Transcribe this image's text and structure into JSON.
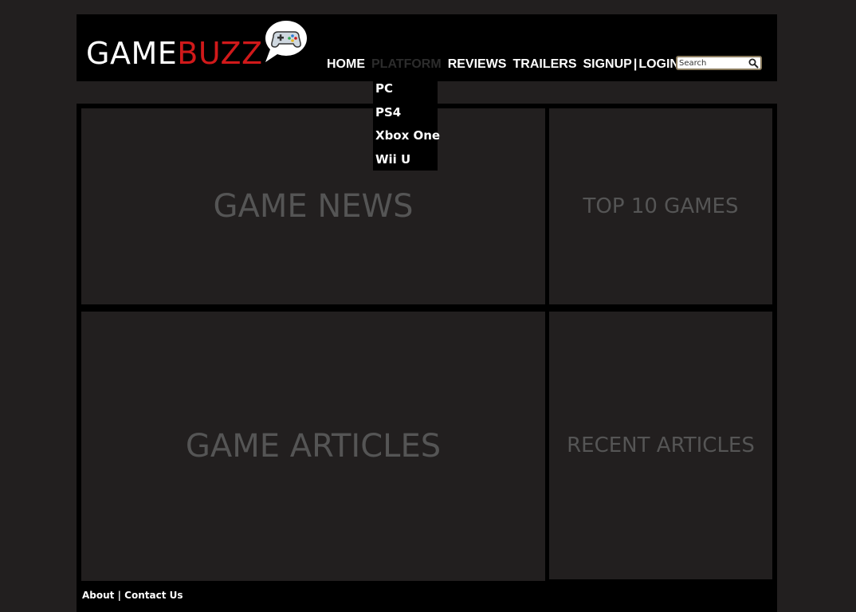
{
  "header": {
    "logo_part1": "GAME",
    "logo_part2": "BUZZ",
    "logo_icon": "gamepad-speech-bubble-icon",
    "brand_red": "#d0191a"
  },
  "nav": {
    "items": [
      "HOME",
      "PLATFORM",
      "REVIEWS",
      "TRAILERS",
      "SIGNUP",
      "LOGIN"
    ],
    "separator": "|",
    "active_item": "PLATFORM"
  },
  "search": {
    "value": "Search",
    "icon": "magnifier-icon"
  },
  "dropdown": {
    "items": [
      "PC",
      "PS4",
      "Xbox One",
      "Wii U"
    ]
  },
  "panels": {
    "news": "GAME NEWS",
    "top10": "TOP 10 GAMES",
    "articles": "GAME ARTICLES",
    "recent": "RECENT ARTICLES"
  },
  "footer": {
    "about": "About",
    "separator": "|",
    "contact": "Contact Us"
  }
}
